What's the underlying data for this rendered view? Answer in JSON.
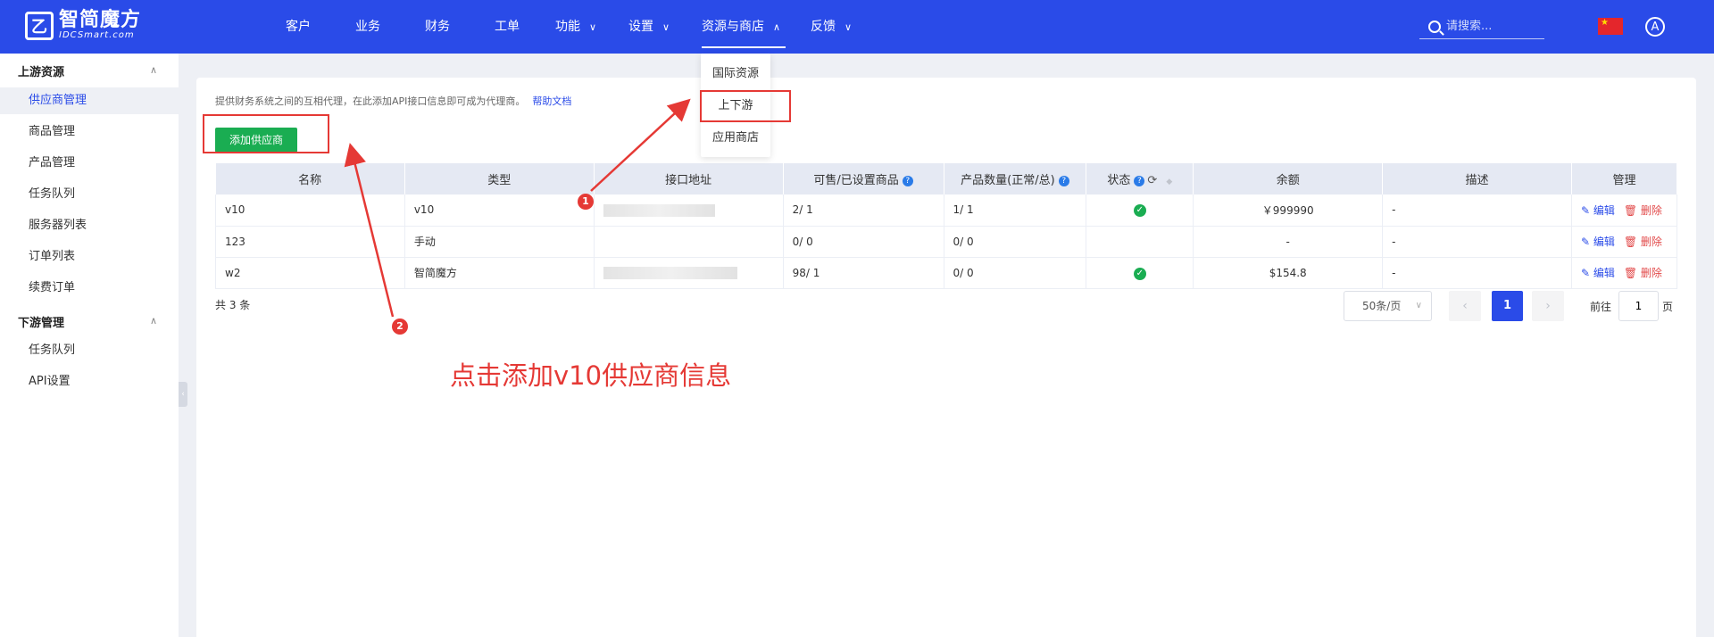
{
  "brand": {
    "name_cn": "智简魔方",
    "name_en": "IDCSmart.com"
  },
  "nav": [
    {
      "label": "客户",
      "chevron": false
    },
    {
      "label": "业务",
      "chevron": false
    },
    {
      "label": "财务",
      "chevron": false
    },
    {
      "label": "工单",
      "chevron": false
    },
    {
      "label": "功能",
      "chevron": true
    },
    {
      "label": "设置",
      "chevron": true
    },
    {
      "label": "资源与商店",
      "chevron": true,
      "active": true
    },
    {
      "label": "反馈",
      "chevron": true
    }
  ],
  "search": {
    "placeholder": "请搜索..."
  },
  "user": {
    "avatar_letter": "A"
  },
  "dropdown": {
    "items": [
      "国际资源",
      "上下游",
      "应用商店"
    ]
  },
  "sidebar": {
    "groups": [
      {
        "title": "上游资源",
        "items": [
          "供应商管理",
          "商品管理",
          "产品管理",
          "任务队列",
          "服务器列表",
          "订单列表",
          "续费订单"
        ]
      },
      {
        "title": "下游管理",
        "items": [
          "任务队列",
          "API设置"
        ]
      }
    ],
    "active_item": "供应商管理"
  },
  "main": {
    "description": "提供财务系统之间的互相代理，在此添加API接口信息即可成为代理商。",
    "help_link": "帮助文档",
    "add_button": "添加供应商",
    "table": {
      "headers": [
        "名称",
        "类型",
        "接口地址",
        "可售/已设置商品",
        "产品数量(正常/总)",
        "状态",
        "余额",
        "描述",
        "管理"
      ],
      "rows": [
        {
          "name": "v10",
          "type": "v10",
          "url": "",
          "goods": "2/ 1",
          "products": "1/ 1",
          "status": "ok",
          "balance": "￥999990",
          "desc": "-"
        },
        {
          "name": "123",
          "type": "手动",
          "url": "",
          "goods": "0/ 0",
          "products": "0/ 0",
          "status": "",
          "balance": "-",
          "desc": "-"
        },
        {
          "name": "w2",
          "type": "智简魔方",
          "url": "",
          "goods": "98/ 1",
          "products": "0/ 0",
          "status": "ok",
          "balance": "$154.8",
          "desc": "-"
        }
      ],
      "edit_label": "编辑",
      "delete_label": "删除"
    },
    "total": "共 3 条",
    "pager": {
      "page_size": "50条/页",
      "current": "1",
      "goto_prefix": "前往",
      "goto_value": "1",
      "goto_suffix": "页"
    }
  },
  "annotations": {
    "step1": "1",
    "step2": "2",
    "caption": "点击添加v10供应商信息"
  },
  "colors": {
    "primary": "#2a4be8",
    "success": "#1aad52",
    "danger": "#e53935"
  }
}
